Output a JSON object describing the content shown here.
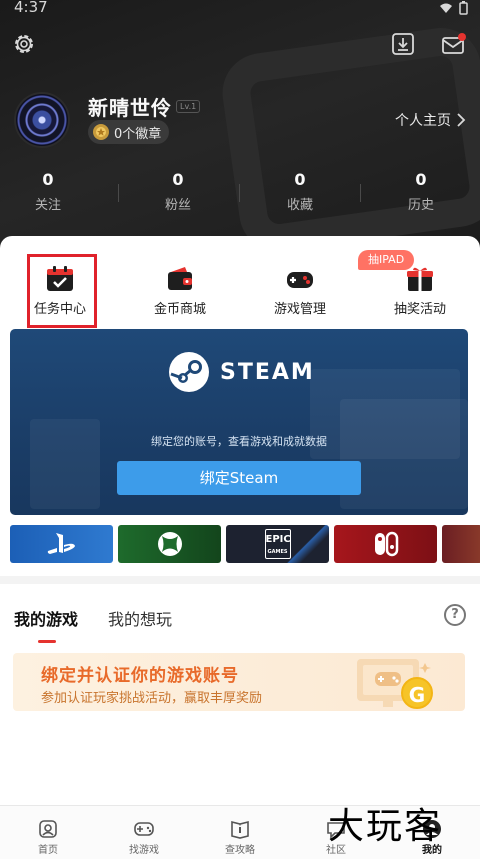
{
  "status_bar": {
    "time": "4:37"
  },
  "header": {
    "username": "新晴世伶",
    "level": "Lv.1",
    "badge_count": "0个徽章",
    "homepage_link": "个人主页",
    "stats": [
      {
        "value": "0",
        "label": "关注"
      },
      {
        "value": "0",
        "label": "粉丝"
      },
      {
        "value": "0",
        "label": "收藏"
      },
      {
        "value": "0",
        "label": "历史"
      }
    ]
  },
  "quick_actions": [
    {
      "label": "任务中心",
      "icon": "calendar-check-icon"
    },
    {
      "label": "金币商城",
      "icon": "wallet-icon"
    },
    {
      "label": "游戏管理",
      "icon": "gamepad-icon"
    },
    {
      "label": "抽奖活动",
      "icon": "gift-icon",
      "tag": "抽IPAD"
    }
  ],
  "steam_card": {
    "logo_text": "STEAM",
    "subtitle": "绑定您的账号，查看游戏和成就数据",
    "button_label": "绑定Steam"
  },
  "platforms": [
    {
      "name": "playstation",
      "color": "#1c5fb6"
    },
    {
      "name": "xbox",
      "color": "#1e6b2c"
    },
    {
      "name": "epic-games",
      "color": "#1d2230",
      "text_top": "EPIC",
      "text_bottom": "GAMES"
    },
    {
      "name": "nintendo-switch",
      "color": "#a6161c"
    },
    {
      "name": "other-platform",
      "color": "#6b1e23"
    }
  ],
  "tabs": {
    "my_games": "我的游戏",
    "wishlist": "我的想玩",
    "help": "?"
  },
  "bind_banner": {
    "title": "绑定并认证你的游戏账号",
    "subtitle": "参加认证玩家挑战活动，赢取丰厚奖励",
    "coin": "G"
  },
  "bottom_nav": [
    {
      "label": "首页",
      "icon": "home-icon"
    },
    {
      "label": "找游戏",
      "icon": "gamepad-icon"
    },
    {
      "label": "查攻略",
      "icon": "guide-icon"
    },
    {
      "label": "社区",
      "icon": "chat-icon"
    },
    {
      "label": "我的",
      "icon": "profile-icon"
    }
  ],
  "watermark": "大玩客",
  "colors": {
    "accent": "#e5332f",
    "steam_button": "#3d9cea",
    "banner_title": "#e86a2a"
  }
}
